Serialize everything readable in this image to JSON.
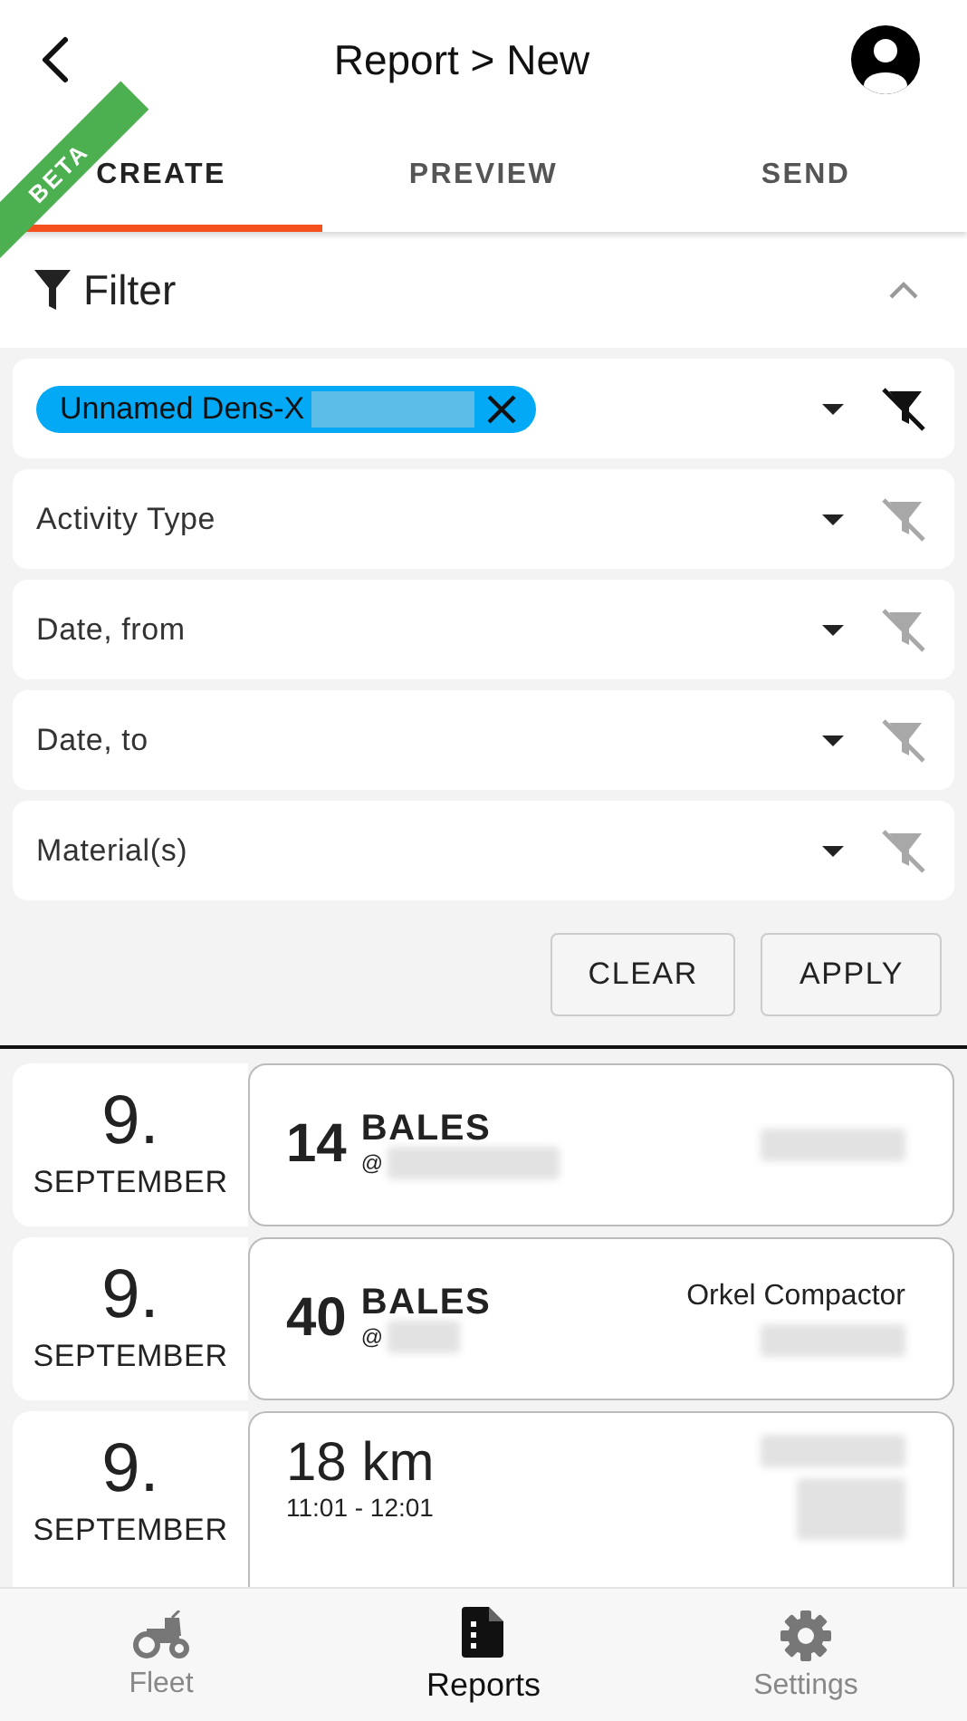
{
  "header": {
    "title": "Report > New"
  },
  "beta_ribbon": "BETA",
  "tabs": [
    {
      "label": "CREATE",
      "selected": true
    },
    {
      "label": "PREVIEW",
      "selected": false
    },
    {
      "label": "SEND",
      "selected": false
    }
  ],
  "filter": {
    "title": "Filter",
    "expanded": true,
    "fields": [
      {
        "kind": "chip",
        "chip_label": "Unnamed Dens-X",
        "active": true
      },
      {
        "kind": "placeholder",
        "placeholder": "Activity Type",
        "active": false
      },
      {
        "kind": "placeholder",
        "placeholder": "Date, from",
        "active": false
      },
      {
        "kind": "placeholder",
        "placeholder": "Date, to",
        "active": false
      },
      {
        "kind": "placeholder",
        "placeholder": "Material(s)",
        "active": false
      }
    ],
    "buttons": [
      "CLEAR",
      "APPLY"
    ]
  },
  "entries": [
    {
      "day": "9.",
      "month": "SEPTEMBER",
      "kind": "count",
      "amount": "14",
      "unit": "BALES",
      "at": "@"
    },
    {
      "day": "9.",
      "month": "SEPTEMBER",
      "kind": "count",
      "amount": "40",
      "unit": "BALES",
      "at": "@",
      "machine": "Orkel Compactor"
    },
    {
      "day": "9.",
      "month": "SEPTEMBER",
      "kind": "distance",
      "distance": "18 km",
      "time": "11:01 - 12:01"
    }
  ],
  "bottom_nav": [
    {
      "label": "Fleet",
      "selected": false
    },
    {
      "label": "Reports",
      "selected": true
    },
    {
      "label": "Settings",
      "selected": false
    }
  ]
}
